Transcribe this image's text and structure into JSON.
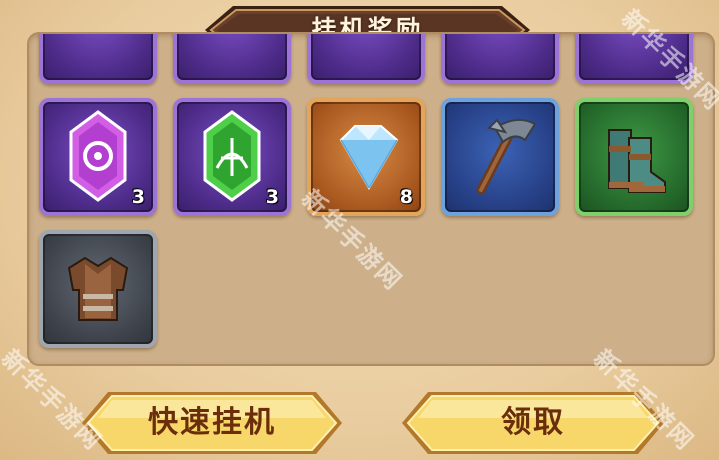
{
  "title": "挂机奖励",
  "rewards": [
    {
      "name": "purple-crystal",
      "rarity": "purple",
      "count": "3"
    },
    {
      "name": "green-crystal",
      "rarity": "purple",
      "count": "3"
    },
    {
      "name": "diamond",
      "rarity": "orange",
      "count": "8"
    },
    {
      "name": "battle-axe",
      "rarity": "blue",
      "count": ""
    },
    {
      "name": "boots",
      "rarity": "green",
      "count": ""
    },
    {
      "name": "chest-armor",
      "rarity": "gray",
      "count": ""
    }
  ],
  "buttons": {
    "quick_idle": "快速挂机",
    "claim": "领取"
  },
  "watermark": "新华手游网",
  "colors": {
    "title_plate": "#5a3524",
    "button_gold": "#f7d66a",
    "panel": "#cdb08a"
  }
}
